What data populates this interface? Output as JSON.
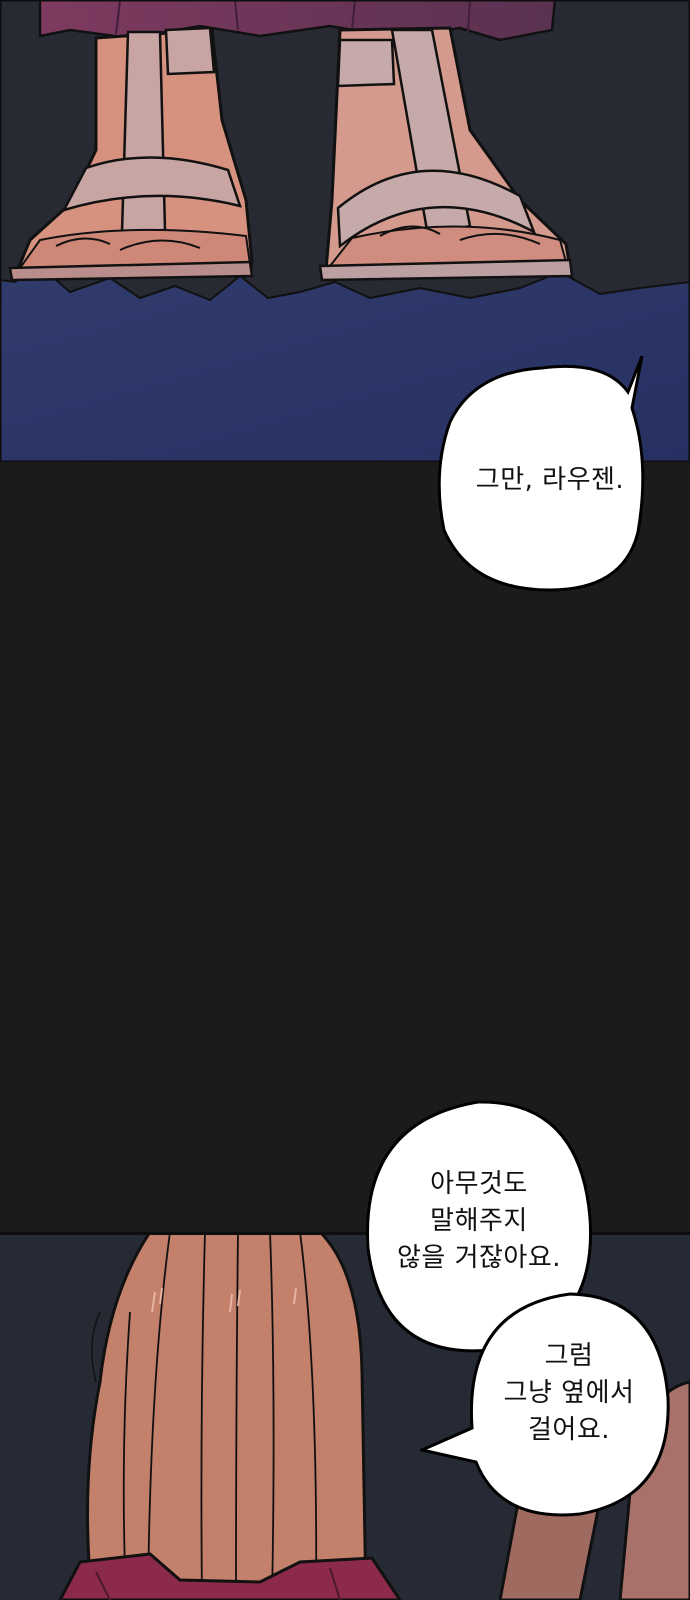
{
  "dialogue": {
    "bubble_1": {
      "line_1": "그만, 라우젠."
    },
    "bubble_2": {
      "line_1": "아무것도",
      "line_2": "말해주지",
      "line_3": "않을 거잖아요."
    },
    "bubble_3": {
      "line_1": "그럼",
      "line_2": "그냥 옆에서",
      "line_3": "걸어요."
    }
  },
  "colors": {
    "night_floor": "#2b3563",
    "gutter": "#1b1b1d",
    "background_dark": "#272933",
    "robe": "#8a3f63",
    "skin": "#d79584",
    "bandage": "#c9aaa6",
    "hair": "#c3806a",
    "bubble_fill": "#ffffff",
    "bubble_outline": "#000000"
  },
  "icons": [
    "speech-bubble-tail"
  ]
}
